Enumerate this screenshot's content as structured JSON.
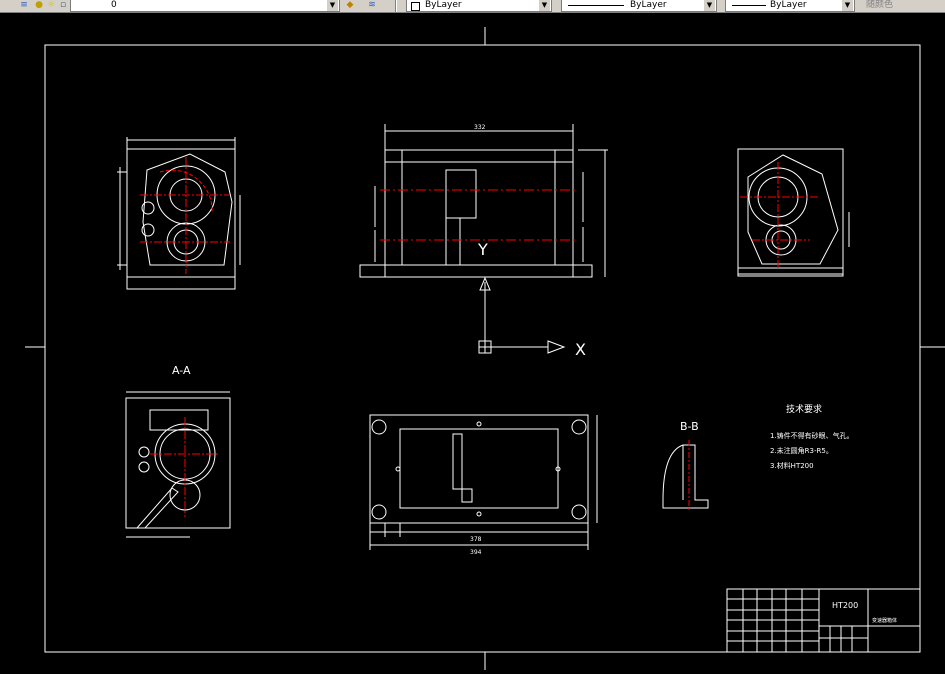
{
  "toolbar": {
    "layer_value": "0",
    "color_value": "ByLayer",
    "linetype_value": "ByLayer",
    "lineweight_value": "ByLayer",
    "plotstyle_value": "随颜色",
    "icons": [
      "layer-manager-icon",
      "layer-state-icon",
      "make-object-layer-current-icon",
      "layer-previous-icon"
    ]
  },
  "drawing": {
    "top_view": {
      "dims": [
        "332"
      ]
    },
    "section_aa": {
      "label": "A-A"
    },
    "section_bb": {
      "label": "B-B"
    },
    "front_view": {
      "dims": [
        "378",
        "394"
      ]
    },
    "tech_req": {
      "title": "技术要求",
      "lines": [
        "1.铸件不得有砂眼、气孔。",
        "2.未注圆角R3-R5。",
        "3.材料HT200"
      ]
    },
    "title_block": {
      "material": "HT200",
      "name": "变速器箱体"
    },
    "ucs": {
      "x": "X",
      "y": "Y"
    }
  },
  "colors": {
    "frame": "#ffffff",
    "centerline": "#ff0000",
    "dimension": "#ffffff",
    "background": "#000000"
  }
}
